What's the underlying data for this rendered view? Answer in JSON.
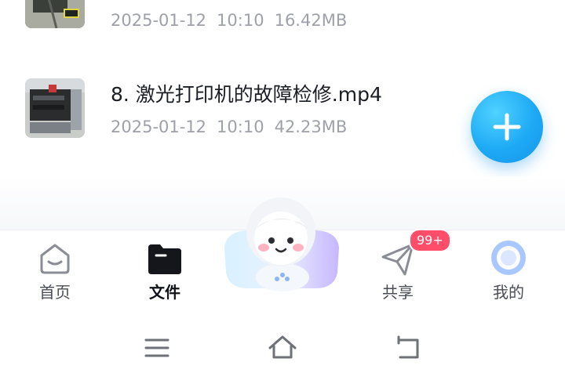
{
  "files": [
    {
      "name": "",
      "date": "2025-01-12",
      "time": "10:10",
      "size": "16.42MB",
      "thumb": "printer-thumbnail"
    },
    {
      "name": "8. 激光打印机的故障检修.mp4",
      "date": "2025-01-12",
      "time": "10:10",
      "size": "42.23MB",
      "thumb": "printer-thumbnail"
    }
  ],
  "fab": {
    "icon": "plus-icon",
    "color": "#1ea9f5"
  },
  "tabs": [
    {
      "label": "首页",
      "icon": "home-icon",
      "active": false
    },
    {
      "label": "文件",
      "icon": "folder-icon",
      "active": true
    },
    {
      "label": "共享",
      "icon": "send-icon",
      "active": false,
      "badge": "99+"
    },
    {
      "label": "我的",
      "icon": "profile-icon",
      "active": false
    }
  ],
  "system_nav": [
    {
      "icon": "menu-icon"
    },
    {
      "icon": "home-nav-icon"
    },
    {
      "icon": "back-icon"
    }
  ],
  "colors": {
    "accent": "#1ea9f5",
    "badge": "#ff4d6a",
    "text": "#1b1d24",
    "meta": "#9ea1a9"
  }
}
